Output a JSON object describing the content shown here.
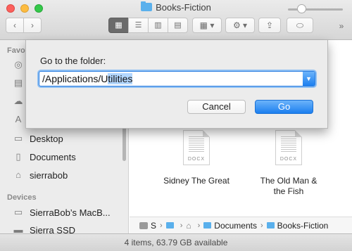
{
  "window": {
    "title": "Books-Fiction"
  },
  "toolbar": {
    "back_glyph": "‹",
    "forward_glyph": "›",
    "view_modes": [
      {
        "glyph": "▦",
        "icon": "icon-view-icon",
        "active": true
      },
      {
        "glyph": "☰",
        "icon": "list-view-icon",
        "active": false
      },
      {
        "glyph": "▥",
        "icon": "column-view-icon",
        "active": false
      },
      {
        "glyph": "▤",
        "icon": "cover-flow-icon",
        "active": false
      }
    ],
    "arrange_glyph": "▦ ▾",
    "action_glyph": "⚙ ▾",
    "share_glyph": "⇪",
    "tags_glyph": "⬭",
    "more_glyph": "»"
  },
  "sidebar": {
    "favorites_header": "Favo",
    "favorites": [
      {
        "label": "",
        "icon": "airdrop-icon",
        "glyph": "◎"
      },
      {
        "label": "",
        "icon": "all-files-icon",
        "glyph": "▤"
      },
      {
        "label": "",
        "icon": "icloud-icon",
        "glyph": "☁"
      },
      {
        "label": "",
        "icon": "applications-icon",
        "glyph": "A"
      },
      {
        "label": "Desktop",
        "icon": "desktop-icon",
        "glyph": "▭"
      },
      {
        "label": "Documents",
        "icon": "documents-icon",
        "glyph": "▯"
      },
      {
        "label": "sierrabob",
        "icon": "home-icon",
        "glyph": "⌂"
      }
    ],
    "devices_header": "Devices",
    "devices": [
      {
        "label": "SierraBob’s MacB...",
        "icon": "laptop-icon",
        "glyph": "▭"
      },
      {
        "label": "Sierra SSD",
        "icon": "disk-icon",
        "glyph": "▬"
      }
    ]
  },
  "files": [
    {
      "name_line1": "Sidney The Great",
      "name_line2": "",
      "ext": "DOCX"
    },
    {
      "name_line1": "The Old Man &",
      "name_line2": "the Fish",
      "ext": "DOCX"
    }
  ],
  "pathbar": {
    "seg1": "S",
    "seg2": "",
    "seg3": "",
    "seg4": "Documents",
    "seg5": "Books-Fiction"
  },
  "statusbar": {
    "text": "4 items, 63.79 GB available",
    "zoom": 0.2
  },
  "sheet": {
    "label": "Go to the folder:",
    "path_prefix": "/Applications/U",
    "path_selected": "tilities",
    "cancel_label": "Cancel",
    "go_label": "Go"
  },
  "colors": {
    "accent": "#1c7fef",
    "folder": "#5ab0ec"
  }
}
